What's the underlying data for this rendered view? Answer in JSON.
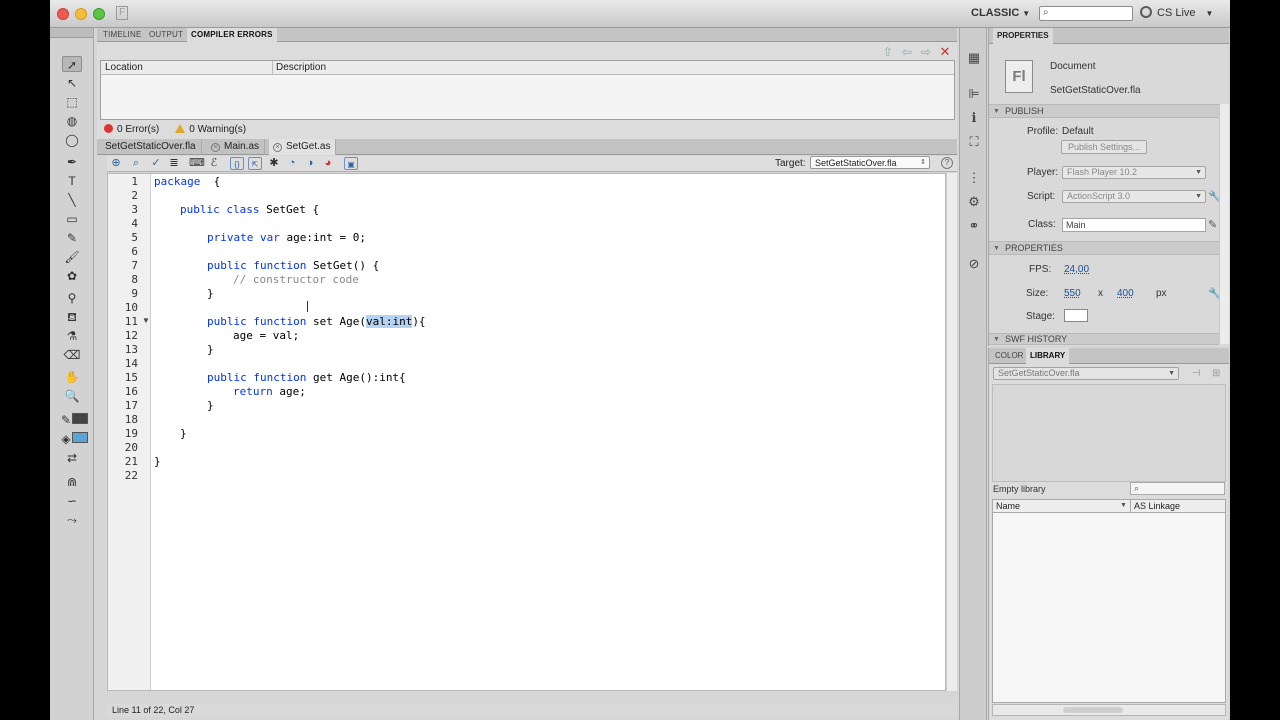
{
  "app": {
    "workspace": "CLASSIC",
    "cs_live": "CS Live",
    "search_placeholder": ""
  },
  "compiler_panel": {
    "tabs": [
      {
        "label": "TIMELINE"
      },
      {
        "label": "OUTPUT"
      },
      {
        "label": "COMPILER ERRORS",
        "active": true
      }
    ],
    "columns": [
      "Location",
      "Description"
    ],
    "errors": "0 Error(s)",
    "warnings": "0 Warning(s)"
  },
  "doc_tabs": [
    {
      "label": "SetGetStaticOver.fla"
    },
    {
      "label": "Main.as"
    },
    {
      "label": "SetGet.as",
      "active": true
    }
  ],
  "editor": {
    "target_label": "Target:",
    "target_value": "SetGetStaticOver.fla",
    "status": "Line 11 of 22, Col 27",
    "lines": [
      "1",
      "2",
      "3",
      "4",
      "5",
      "6",
      "7",
      "8",
      "9",
      "10",
      "11",
      "12",
      "13",
      "14",
      "15",
      "16",
      "17",
      "18",
      "19",
      "20",
      "21",
      "22"
    ],
    "code": {
      "l1_kw": "package",
      "l1_rest": "  {",
      "l3_kw": "public class",
      "l3_rest": " SetGet {",
      "l5_kw": "private var",
      "l5_rest": " age:int = 0;",
      "l7_kw": "public function",
      "l7_rest": " SetGet() {",
      "l8_comment": "// constructor code",
      "l9": "}",
      "l11_kw": "public function",
      "l11_rest_a": " set Age(",
      "l11_sel": "val:int",
      "l11_rest_b": "){",
      "l12": "age = val;",
      "l13": "}",
      "l15_kw": "public function",
      "l15_rest": " get Age():int{",
      "l16_kw": "return",
      "l16_rest": " age;",
      "l17": "}",
      "l19": "}",
      "l21": "}"
    }
  },
  "properties": {
    "header": "PROPERTIES",
    "doc_type": "Document",
    "doc_name": "SetGetStaticOver.fla",
    "fl_badge": "Fl",
    "publish_section": "PUBLISH",
    "profile_label": "Profile:",
    "profile_value": "Default",
    "publish_settings_btn": "Publish Settings...",
    "player_label": "Player:",
    "player_value": "Flash Player 10.2",
    "script_label": "Script:",
    "script_value": "ActionScript 3.0",
    "class_label": "Class:",
    "class_value": "Main",
    "properties_section": "PROPERTIES",
    "fps_label": "FPS:",
    "fps_value": "24,00",
    "size_label": "Size:",
    "size_w": "550",
    "size_x": "x",
    "size_h": "400",
    "size_unit": "px",
    "stage_label": "Stage:",
    "swf_history": "SWF HISTORY"
  },
  "library": {
    "tabs": [
      {
        "label": "COLOR"
      },
      {
        "label": "LIBRARY",
        "active": true
      }
    ],
    "file": "SetGetStaticOver.fla",
    "empty": "Empty library",
    "col_name": "Name",
    "col_linkage": "AS Linkage"
  }
}
